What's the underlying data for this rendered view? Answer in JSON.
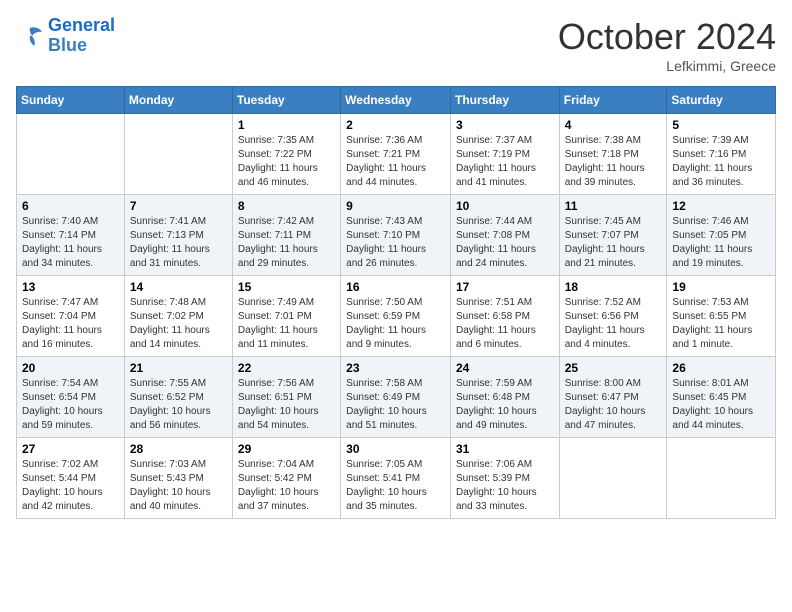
{
  "header": {
    "logo_line1": "General",
    "logo_line2": "Blue",
    "month": "October 2024",
    "location": "Lefkimmi, Greece"
  },
  "days_of_week": [
    "Sunday",
    "Monday",
    "Tuesday",
    "Wednesday",
    "Thursday",
    "Friday",
    "Saturday"
  ],
  "weeks": [
    [
      {
        "num": "",
        "info": ""
      },
      {
        "num": "",
        "info": ""
      },
      {
        "num": "1",
        "info": "Sunrise: 7:35 AM\nSunset: 7:22 PM\nDaylight: 11 hours and 46 minutes."
      },
      {
        "num": "2",
        "info": "Sunrise: 7:36 AM\nSunset: 7:21 PM\nDaylight: 11 hours and 44 minutes."
      },
      {
        "num": "3",
        "info": "Sunrise: 7:37 AM\nSunset: 7:19 PM\nDaylight: 11 hours and 41 minutes."
      },
      {
        "num": "4",
        "info": "Sunrise: 7:38 AM\nSunset: 7:18 PM\nDaylight: 11 hours and 39 minutes."
      },
      {
        "num": "5",
        "info": "Sunrise: 7:39 AM\nSunset: 7:16 PM\nDaylight: 11 hours and 36 minutes."
      }
    ],
    [
      {
        "num": "6",
        "info": "Sunrise: 7:40 AM\nSunset: 7:14 PM\nDaylight: 11 hours and 34 minutes."
      },
      {
        "num": "7",
        "info": "Sunrise: 7:41 AM\nSunset: 7:13 PM\nDaylight: 11 hours and 31 minutes."
      },
      {
        "num": "8",
        "info": "Sunrise: 7:42 AM\nSunset: 7:11 PM\nDaylight: 11 hours and 29 minutes."
      },
      {
        "num": "9",
        "info": "Sunrise: 7:43 AM\nSunset: 7:10 PM\nDaylight: 11 hours and 26 minutes."
      },
      {
        "num": "10",
        "info": "Sunrise: 7:44 AM\nSunset: 7:08 PM\nDaylight: 11 hours and 24 minutes."
      },
      {
        "num": "11",
        "info": "Sunrise: 7:45 AM\nSunset: 7:07 PM\nDaylight: 11 hours and 21 minutes."
      },
      {
        "num": "12",
        "info": "Sunrise: 7:46 AM\nSunset: 7:05 PM\nDaylight: 11 hours and 19 minutes."
      }
    ],
    [
      {
        "num": "13",
        "info": "Sunrise: 7:47 AM\nSunset: 7:04 PM\nDaylight: 11 hours and 16 minutes."
      },
      {
        "num": "14",
        "info": "Sunrise: 7:48 AM\nSunset: 7:02 PM\nDaylight: 11 hours and 14 minutes."
      },
      {
        "num": "15",
        "info": "Sunrise: 7:49 AM\nSunset: 7:01 PM\nDaylight: 11 hours and 11 minutes."
      },
      {
        "num": "16",
        "info": "Sunrise: 7:50 AM\nSunset: 6:59 PM\nDaylight: 11 hours and 9 minutes."
      },
      {
        "num": "17",
        "info": "Sunrise: 7:51 AM\nSunset: 6:58 PM\nDaylight: 11 hours and 6 minutes."
      },
      {
        "num": "18",
        "info": "Sunrise: 7:52 AM\nSunset: 6:56 PM\nDaylight: 11 hours and 4 minutes."
      },
      {
        "num": "19",
        "info": "Sunrise: 7:53 AM\nSunset: 6:55 PM\nDaylight: 11 hours and 1 minute."
      }
    ],
    [
      {
        "num": "20",
        "info": "Sunrise: 7:54 AM\nSunset: 6:54 PM\nDaylight: 10 hours and 59 minutes."
      },
      {
        "num": "21",
        "info": "Sunrise: 7:55 AM\nSunset: 6:52 PM\nDaylight: 10 hours and 56 minutes."
      },
      {
        "num": "22",
        "info": "Sunrise: 7:56 AM\nSunset: 6:51 PM\nDaylight: 10 hours and 54 minutes."
      },
      {
        "num": "23",
        "info": "Sunrise: 7:58 AM\nSunset: 6:49 PM\nDaylight: 10 hours and 51 minutes."
      },
      {
        "num": "24",
        "info": "Sunrise: 7:59 AM\nSunset: 6:48 PM\nDaylight: 10 hours and 49 minutes."
      },
      {
        "num": "25",
        "info": "Sunrise: 8:00 AM\nSunset: 6:47 PM\nDaylight: 10 hours and 47 minutes."
      },
      {
        "num": "26",
        "info": "Sunrise: 8:01 AM\nSunset: 6:45 PM\nDaylight: 10 hours and 44 minutes."
      }
    ],
    [
      {
        "num": "27",
        "info": "Sunrise: 7:02 AM\nSunset: 5:44 PM\nDaylight: 10 hours and 42 minutes."
      },
      {
        "num": "28",
        "info": "Sunrise: 7:03 AM\nSunset: 5:43 PM\nDaylight: 10 hours and 40 minutes."
      },
      {
        "num": "29",
        "info": "Sunrise: 7:04 AM\nSunset: 5:42 PM\nDaylight: 10 hours and 37 minutes."
      },
      {
        "num": "30",
        "info": "Sunrise: 7:05 AM\nSunset: 5:41 PM\nDaylight: 10 hours and 35 minutes."
      },
      {
        "num": "31",
        "info": "Sunrise: 7:06 AM\nSunset: 5:39 PM\nDaylight: 10 hours and 33 minutes."
      },
      {
        "num": "",
        "info": ""
      },
      {
        "num": "",
        "info": ""
      }
    ]
  ]
}
